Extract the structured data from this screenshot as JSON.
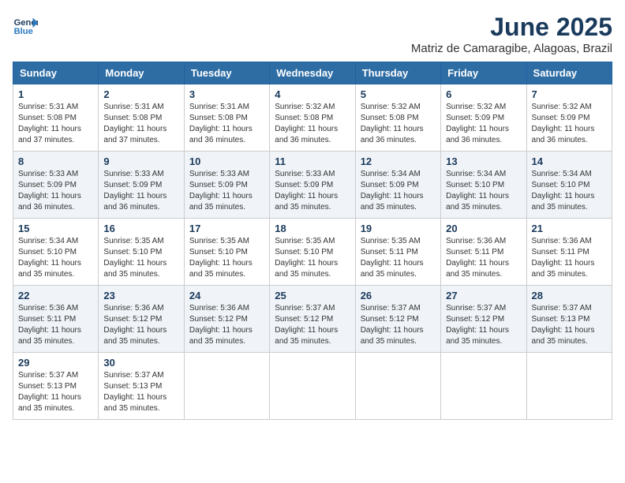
{
  "header": {
    "logo_line1": "General",
    "logo_line2": "Blue",
    "title": "June 2025",
    "subtitle": "Matriz de Camaragibe, Alagoas, Brazil"
  },
  "weekdays": [
    "Sunday",
    "Monday",
    "Tuesday",
    "Wednesday",
    "Thursday",
    "Friday",
    "Saturday"
  ],
  "weeks": [
    [
      {
        "day": "1",
        "sunrise": "5:31 AM",
        "sunset": "5:08 PM",
        "daylight": "11 hours and 37 minutes."
      },
      {
        "day": "2",
        "sunrise": "5:31 AM",
        "sunset": "5:08 PM",
        "daylight": "11 hours and 37 minutes."
      },
      {
        "day": "3",
        "sunrise": "5:31 AM",
        "sunset": "5:08 PM",
        "daylight": "11 hours and 36 minutes."
      },
      {
        "day": "4",
        "sunrise": "5:32 AM",
        "sunset": "5:08 PM",
        "daylight": "11 hours and 36 minutes."
      },
      {
        "day": "5",
        "sunrise": "5:32 AM",
        "sunset": "5:08 PM",
        "daylight": "11 hours and 36 minutes."
      },
      {
        "day": "6",
        "sunrise": "5:32 AM",
        "sunset": "5:09 PM",
        "daylight": "11 hours and 36 minutes."
      },
      {
        "day": "7",
        "sunrise": "5:32 AM",
        "sunset": "5:09 PM",
        "daylight": "11 hours and 36 minutes."
      }
    ],
    [
      {
        "day": "8",
        "sunrise": "5:33 AM",
        "sunset": "5:09 PM",
        "daylight": "11 hours and 36 minutes."
      },
      {
        "day": "9",
        "sunrise": "5:33 AM",
        "sunset": "5:09 PM",
        "daylight": "11 hours and 36 minutes."
      },
      {
        "day": "10",
        "sunrise": "5:33 AM",
        "sunset": "5:09 PM",
        "daylight": "11 hours and 35 minutes."
      },
      {
        "day": "11",
        "sunrise": "5:33 AM",
        "sunset": "5:09 PM",
        "daylight": "11 hours and 35 minutes."
      },
      {
        "day": "12",
        "sunrise": "5:34 AM",
        "sunset": "5:09 PM",
        "daylight": "11 hours and 35 minutes."
      },
      {
        "day": "13",
        "sunrise": "5:34 AM",
        "sunset": "5:10 PM",
        "daylight": "11 hours and 35 minutes."
      },
      {
        "day": "14",
        "sunrise": "5:34 AM",
        "sunset": "5:10 PM",
        "daylight": "11 hours and 35 minutes."
      }
    ],
    [
      {
        "day": "15",
        "sunrise": "5:34 AM",
        "sunset": "5:10 PM",
        "daylight": "11 hours and 35 minutes."
      },
      {
        "day": "16",
        "sunrise": "5:35 AM",
        "sunset": "5:10 PM",
        "daylight": "11 hours and 35 minutes."
      },
      {
        "day": "17",
        "sunrise": "5:35 AM",
        "sunset": "5:10 PM",
        "daylight": "11 hours and 35 minutes."
      },
      {
        "day": "18",
        "sunrise": "5:35 AM",
        "sunset": "5:10 PM",
        "daylight": "11 hours and 35 minutes."
      },
      {
        "day": "19",
        "sunrise": "5:35 AM",
        "sunset": "5:11 PM",
        "daylight": "11 hours and 35 minutes."
      },
      {
        "day": "20",
        "sunrise": "5:36 AM",
        "sunset": "5:11 PM",
        "daylight": "11 hours and 35 minutes."
      },
      {
        "day": "21",
        "sunrise": "5:36 AM",
        "sunset": "5:11 PM",
        "daylight": "11 hours and 35 minutes."
      }
    ],
    [
      {
        "day": "22",
        "sunrise": "5:36 AM",
        "sunset": "5:11 PM",
        "daylight": "11 hours and 35 minutes."
      },
      {
        "day": "23",
        "sunrise": "5:36 AM",
        "sunset": "5:12 PM",
        "daylight": "11 hours and 35 minutes."
      },
      {
        "day": "24",
        "sunrise": "5:36 AM",
        "sunset": "5:12 PM",
        "daylight": "11 hours and 35 minutes."
      },
      {
        "day": "25",
        "sunrise": "5:37 AM",
        "sunset": "5:12 PM",
        "daylight": "11 hours and 35 minutes."
      },
      {
        "day": "26",
        "sunrise": "5:37 AM",
        "sunset": "5:12 PM",
        "daylight": "11 hours and 35 minutes."
      },
      {
        "day": "27",
        "sunrise": "5:37 AM",
        "sunset": "5:12 PM",
        "daylight": "11 hours and 35 minutes."
      },
      {
        "day": "28",
        "sunrise": "5:37 AM",
        "sunset": "5:13 PM",
        "daylight": "11 hours and 35 minutes."
      }
    ],
    [
      {
        "day": "29",
        "sunrise": "5:37 AM",
        "sunset": "5:13 PM",
        "daylight": "11 hours and 35 minutes."
      },
      {
        "day": "30",
        "sunrise": "5:37 AM",
        "sunset": "5:13 PM",
        "daylight": "11 hours and 35 minutes."
      },
      null,
      null,
      null,
      null,
      null
    ]
  ],
  "labels": {
    "sunrise": "Sunrise: ",
    "sunset": "Sunset: ",
    "daylight": "Daylight: "
  }
}
